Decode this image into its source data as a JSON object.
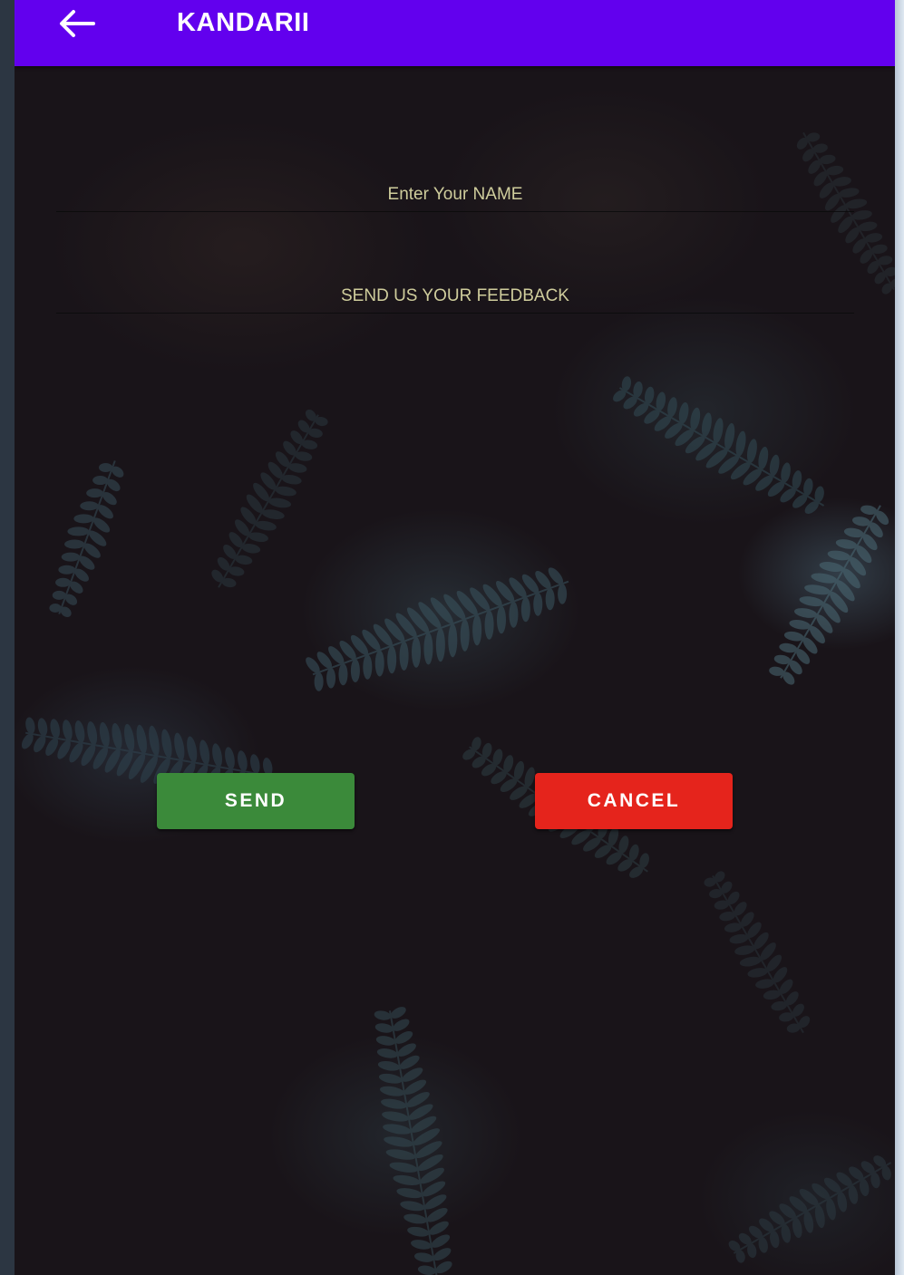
{
  "app_bar": {
    "title": "KANDARII",
    "back_icon": "arrow-left-icon",
    "color": "#6200ee"
  },
  "form": {
    "name_field": {
      "placeholder": "Enter Your NAME",
      "value": ""
    },
    "feedback_field": {
      "placeholder": "SEND US YOUR FEEDBACK",
      "value": ""
    }
  },
  "actions": {
    "send_label": "SEND",
    "send_color": "#3b8a3a",
    "cancel_label": "CANCEL",
    "cancel_color": "#e5241c"
  },
  "background": {
    "description_icon": "fern-leaves-background-image"
  }
}
